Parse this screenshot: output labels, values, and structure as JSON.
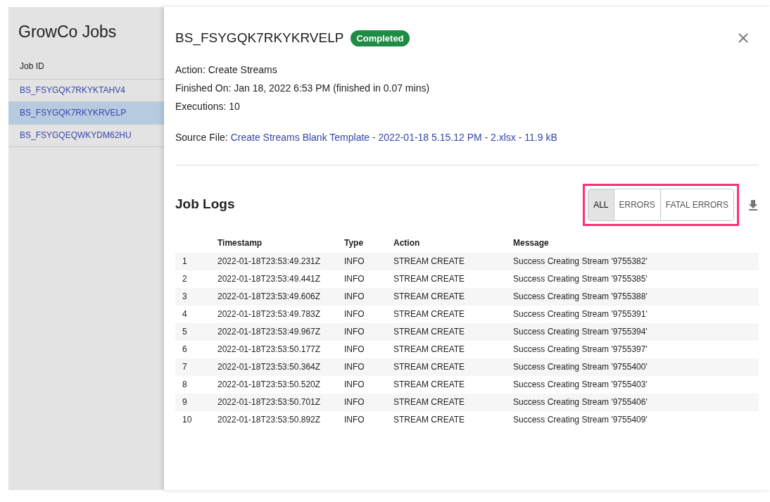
{
  "sidebar": {
    "title": "GrowCo Jobs",
    "column": "Job ID",
    "jobs": [
      {
        "id": "BS_FSYGQK7RKYKTAHV4",
        "selected": false
      },
      {
        "id": "BS_FSYGQK7RKYKRVELP",
        "selected": true
      },
      {
        "id": "BS_FSYGQEQWKYDM62HU",
        "selected": false
      }
    ]
  },
  "dialog": {
    "title": "BS_FSYGQK7RKYKRVELP",
    "status": "Completed",
    "details": [
      "Action: Create Streams",
      "Finished On: Jan 18, 2022 6:53 PM (finished in 0.07 mins)",
      "Executions: 10"
    ],
    "source_label": "Source File:",
    "source_link": "Create Streams Blank Template - 2022-01-18 5.15.12 PM - 2.xlsx - 11.9 kB",
    "logs_title": "Job Logs",
    "filters": [
      {
        "label": "ALL",
        "selected": true
      },
      {
        "label": "ERRORS",
        "selected": false
      },
      {
        "label": "FATAL ERRORS",
        "selected": false
      }
    ],
    "table": {
      "columns": [
        "",
        "Timestamp",
        "Type",
        "Action",
        "Message"
      ],
      "rows": [
        [
          "1",
          "2022-01-18T23:53:49.231Z",
          "INFO",
          "STREAM CREATE",
          "Success Creating Stream '9755382'"
        ],
        [
          "2",
          "2022-01-18T23:53:49.441Z",
          "INFO",
          "STREAM CREATE",
          "Success Creating Stream '9755385'"
        ],
        [
          "3",
          "2022-01-18T23:53:49.606Z",
          "INFO",
          "STREAM CREATE",
          "Success Creating Stream '9755388'"
        ],
        [
          "4",
          "2022-01-18T23:53:49.783Z",
          "INFO",
          "STREAM CREATE",
          "Success Creating Stream '9755391'"
        ],
        [
          "5",
          "2022-01-18T23:53:49.967Z",
          "INFO",
          "STREAM CREATE",
          "Success Creating Stream '9755394'"
        ],
        [
          "6",
          "2022-01-18T23:53:50.177Z",
          "INFO",
          "STREAM CREATE",
          "Success Creating Stream '9755397'"
        ],
        [
          "7",
          "2022-01-18T23:53:50.364Z",
          "INFO",
          "STREAM CREATE",
          "Success Creating Stream '9755400'"
        ],
        [
          "8",
          "2022-01-18T23:53:50.520Z",
          "INFO",
          "STREAM CREATE",
          "Success Creating Stream '9755403'"
        ],
        [
          "9",
          "2022-01-18T23:53:50.701Z",
          "INFO",
          "STREAM CREATE",
          "Success Creating Stream '9755406'"
        ],
        [
          "10",
          "2022-01-18T23:53:50.892Z",
          "INFO",
          "STREAM CREATE",
          "Success Creating Stream '9755409'"
        ]
      ]
    }
  }
}
